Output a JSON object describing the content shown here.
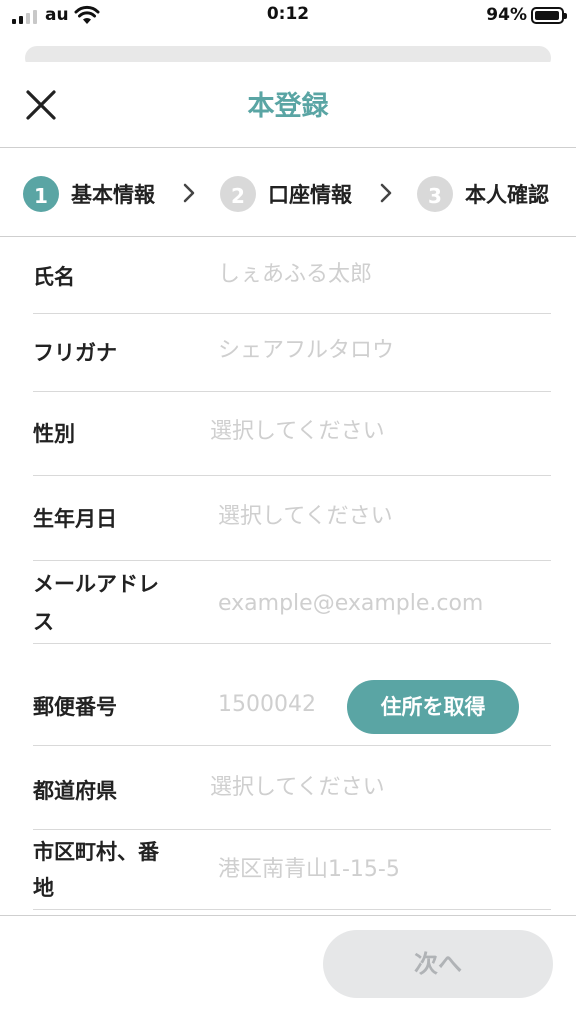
{
  "status_bar": {
    "carrier": "au",
    "time": "0:12",
    "battery_percent": "94%",
    "battery_level": 0.94,
    "signal_bars_active": 2,
    "signal_bars_total": 4,
    "icons": [
      "signal-icon",
      "wifi-icon",
      "battery-icon"
    ]
  },
  "header": {
    "title": "本登録",
    "close_icon": "close-icon"
  },
  "stepper": {
    "steps": [
      {
        "number": "1",
        "label": "基本情報",
        "active": true
      },
      {
        "number": "2",
        "label": "口座情報",
        "active": false
      },
      {
        "number": "3",
        "label": "本人確認",
        "active": false
      }
    ]
  },
  "form": {
    "fields": [
      {
        "label": "氏名",
        "placeholder": "しぇあふる太郎"
      },
      {
        "label": "フリガナ",
        "placeholder": "シェアフルタロウ"
      },
      {
        "label": "性別",
        "placeholder": "選択してください"
      },
      {
        "label": "生年月日",
        "placeholder": "選択してください"
      },
      {
        "label_line1": "メールアドレ",
        "label_line2": "ス",
        "placeholder": "example@example.com"
      },
      {
        "label": "郵便番号",
        "placeholder": "1500042"
      },
      {
        "label": "都道府県",
        "placeholder": "選択してください"
      },
      {
        "label_line1": "市区町村、番",
        "label_line2": "地",
        "placeholder": "港区南青山1-15-5"
      }
    ],
    "get_address_button": "住所を取得"
  },
  "footer": {
    "next_button": "次へ"
  },
  "colors": {
    "accent": "#5aa5a4",
    "placeholder": "#cfcfcf",
    "disabled_button_bg": "#e6e7e8",
    "disabled_button_text": "#b0b3b6"
  }
}
